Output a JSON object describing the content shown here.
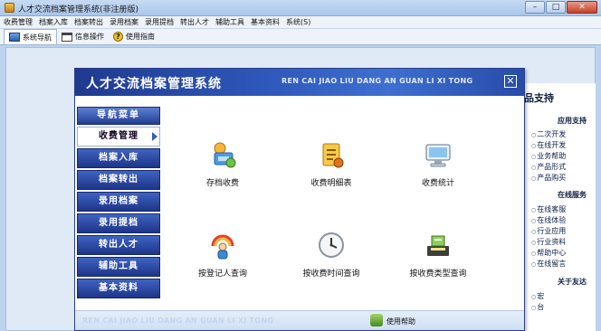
{
  "window": {
    "title": "人才交流档案管理系统(非注册版)",
    "buttons": [
      "–",
      "□",
      "✕"
    ]
  },
  "menubar": [
    "收费管理",
    "档案入库",
    "档案转出",
    "录用档案",
    "录用提档",
    "转出人才",
    "辅助工具",
    "基本资料",
    "系统(S)"
  ],
  "tabs": [
    {
      "label": "系统导航",
      "icon": "monitor-icon"
    },
    {
      "label": "信息操作",
      "icon": "window-icon"
    },
    {
      "label": "使用指南",
      "icon": "help-icon"
    }
  ],
  "dialog": {
    "title": "人才交流档案管理系统",
    "subtitle": "REN CAI JIAO LIU DANG AN GUAN LI XI TONG",
    "close": "✕",
    "footer_text": "REN CAI JIAO LIU DANG AN GUAN LI XI TONG",
    "footer_help": "使用帮助"
  },
  "nav": {
    "header": "导航菜单",
    "items": [
      "收费管理",
      "档案入库",
      "档案转出",
      "录用档案",
      "录用提档",
      "转出人才",
      "辅助工具",
      "基本资料"
    ],
    "selected": "收费管理"
  },
  "functions": [
    {
      "label": "存档收费",
      "icon": "archive-fee-icon"
    },
    {
      "label": "收费明细表",
      "icon": "fee-detail-icon"
    },
    {
      "label": "收费统计",
      "icon": "fee-stats-icon"
    },
    {
      "label": "按登记人查询",
      "icon": "query-by-registrar-icon"
    },
    {
      "label": "按收费时间查询",
      "icon": "query-by-time-icon"
    },
    {
      "label": "按收费类型查询",
      "icon": "query-by-type-icon"
    }
  ],
  "support": {
    "heading": "品支持",
    "sections": [
      {
        "title": "应用支持",
        "links": [
          "二次开发",
          "在线开发",
          "业务帮助",
          "产品形式",
          "产品购买"
        ]
      },
      {
        "title": "在线服务",
        "links": [
          "在线客服",
          "在线体验",
          "行业应用",
          "行业资料",
          "帮助中心",
          "在线留言"
        ]
      },
      {
        "title": "关于友达",
        "links": [
          "宏",
          "台"
        ]
      }
    ]
  },
  "colors": {
    "nav_blue": "#1d3588",
    "header_blue": "#2d56b8",
    "window_bg": "#bcd3ee"
  }
}
